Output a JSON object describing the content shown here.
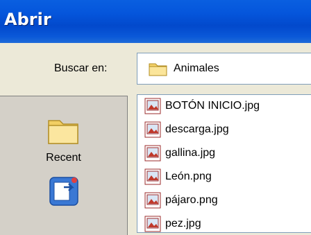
{
  "window": {
    "title": "Abrir"
  },
  "look_in": {
    "label": "Buscar en:",
    "value": "Animales",
    "icon": "folder-icon"
  },
  "places": [
    {
      "label": "Recent",
      "icon": "recent-folder-icon"
    },
    {
      "label": "",
      "icon": "desktop-icon"
    }
  ],
  "files": [
    {
      "name": "BOTÓN INICIO.jpg",
      "icon": "image-file-icon"
    },
    {
      "name": "descarga.jpg",
      "icon": "image-file-icon"
    },
    {
      "name": "gallina.jpg",
      "icon": "image-file-icon"
    },
    {
      "name": "León.png",
      "icon": "image-file-icon"
    },
    {
      "name": "pájaro.png",
      "icon": "image-file-icon"
    },
    {
      "name": "pez.jpg",
      "icon": "image-file-icon"
    }
  ],
  "colors": {
    "titlebar": "#0556dc",
    "dialog_bg": "#ece9d8",
    "places_bg": "#d4d0c8"
  }
}
